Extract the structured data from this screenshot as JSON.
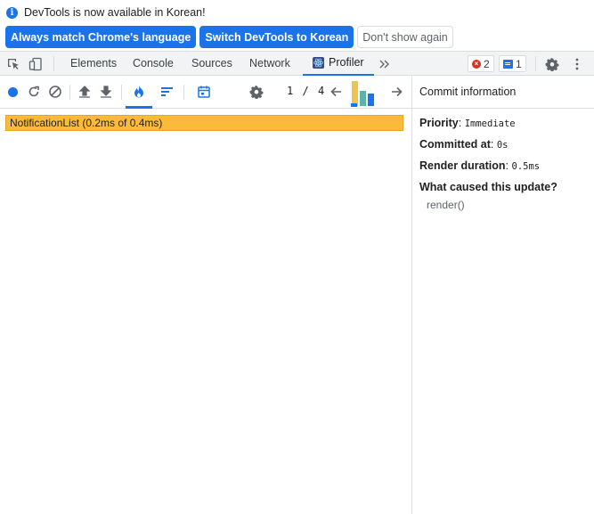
{
  "banner": {
    "message": "DevTools is now available in Korean!",
    "buttons": [
      "Always match Chrome's language",
      "Switch DevTools to Korean",
      "Don't show again"
    ]
  },
  "tabs": {
    "items": [
      "Elements",
      "Console",
      "Sources",
      "Network",
      "Profiler"
    ],
    "active": "Profiler",
    "error_count": "2",
    "message_count": "1"
  },
  "profiler": {
    "commit_index": "1",
    "commit_separator": "/",
    "commit_total": "4",
    "commit_bars": [
      {
        "level": 0.92,
        "color": "#f0c34a",
        "selected": false
      },
      {
        "level": 0.58,
        "color": "#5ab4a8",
        "selected": false
      },
      {
        "level": 0.45,
        "color": "#1a73e8",
        "selected": true
      }
    ]
  },
  "flamegraph": {
    "root_label": "NotificationList (0.2ms of 0.4ms)",
    "root_color": "#fbba3a"
  },
  "commit_info": {
    "title": "Commit information",
    "priority_label": "Priority",
    "priority_value": "Immediate",
    "committed_label": "Committed at",
    "committed_value": "0s",
    "render_label": "Render duration",
    "render_value": "0.5ms",
    "cause_label": "What caused this update?",
    "cause_value": "render()"
  },
  "colors": {
    "accent": "#1a73e8",
    "error": "#d93025"
  }
}
